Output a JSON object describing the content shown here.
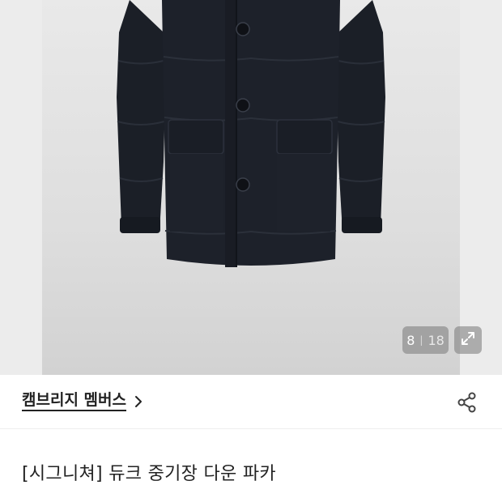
{
  "gallery": {
    "current": "8",
    "separator": "|",
    "total": "18",
    "image_alt_icon": "down-jacket-photo",
    "expand_icon": "expand-icon"
  },
  "brand": {
    "name": "캠브리지 멤버스",
    "chevron_icon": "chevron-right-icon"
  },
  "share_icon": "share-icon",
  "product": {
    "title": "[시그니쳐] 듀크 중기장 다운 파카"
  },
  "colors": {
    "jacket": "#1b1f27",
    "badge_bg": "#7a7a7a",
    "text": "#222222"
  }
}
